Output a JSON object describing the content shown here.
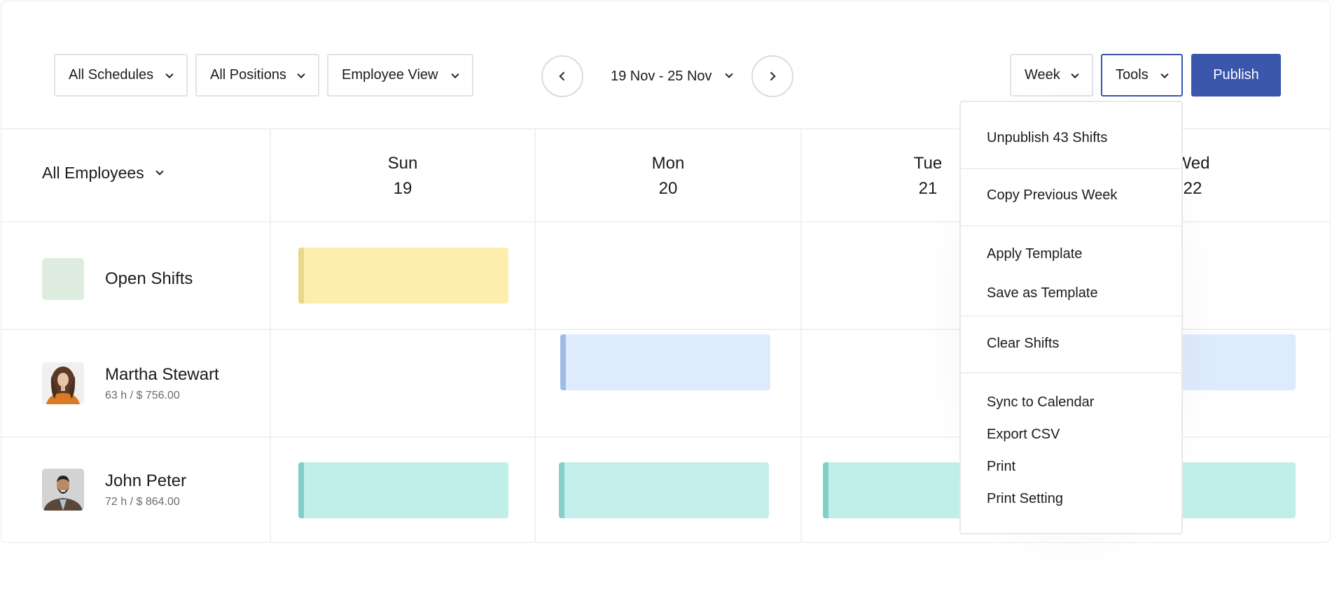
{
  "toolbar": {
    "filters": [
      {
        "label": "All Schedules"
      },
      {
        "label": "All Positions"
      },
      {
        "label": "Employee View"
      }
    ],
    "date_range": "19 Nov - 25 Nov",
    "view_select": "Week",
    "tools_label": "Tools",
    "publish_label": "Publish"
  },
  "grid": {
    "employee_filter": "All Employees",
    "days": [
      {
        "name": "Sun",
        "date": "19"
      },
      {
        "name": "Mon",
        "date": "20"
      },
      {
        "name": "Tue",
        "date": "21"
      },
      {
        "name": "Wed",
        "date": "22"
      }
    ],
    "rows": [
      {
        "name": "Open Shifts",
        "summary": "",
        "avatar": "open-shifts-swatch"
      },
      {
        "name": "Martha Stewart",
        "summary": "63 h / $ 756.00",
        "avatar": "martha-stewart-photo"
      },
      {
        "name": "John Peter",
        "summary": "72 h / $ 864.00",
        "avatar": "john-peter-photo"
      }
    ],
    "shift_colors": {
      "open": {
        "fill": "#feeeae",
        "edge": "#e8d88a"
      },
      "martha": {
        "fill": "#deebfd",
        "edge": "#9fbde4"
      },
      "john": {
        "fill": "#c0eee9",
        "edge": "#83cfc8"
      }
    }
  },
  "tools_menu": {
    "groups": [
      [
        "Unpublish 43 Shifts"
      ],
      [
        "Copy Previous Week"
      ],
      [
        "Apply Template",
        "Save as Template"
      ],
      [
        "Clear Shifts"
      ],
      [
        "Sync to Calendar",
        "Export CSV",
        "Print",
        "Print Setting"
      ]
    ]
  },
  "colors": {
    "accent": "#3a56ad",
    "border": "#dfe3e8",
    "open_shift_swatch": "#deede0"
  }
}
